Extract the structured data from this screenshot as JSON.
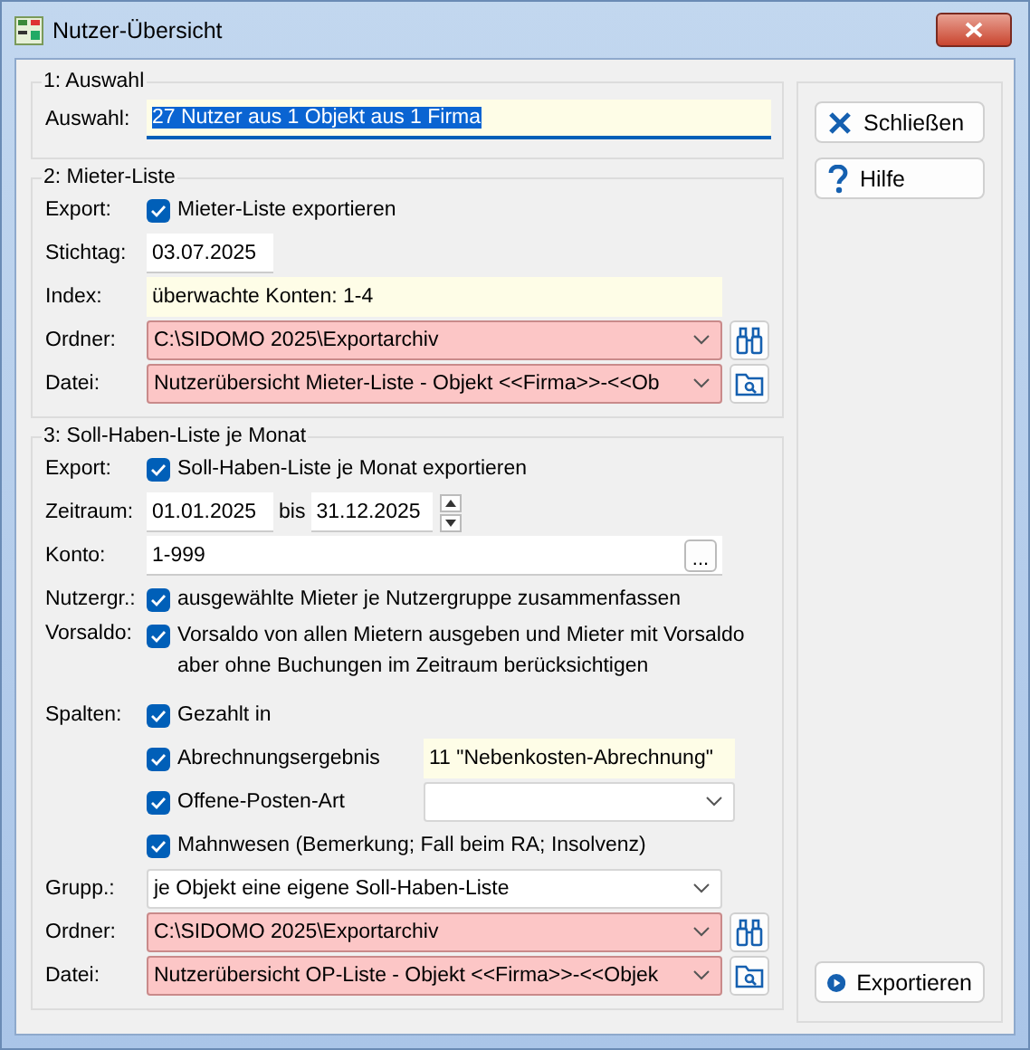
{
  "window": {
    "title": "Nutzer-Übersicht"
  },
  "sections": [
    {
      "title": "1: Auswahl",
      "rows": [
        {
          "kind": "field",
          "label": "Auswahl:",
          "value": "27 Nutzer aus 1 Objekt aus 1 Firma",
          "selected": true,
          "readonly": true,
          "focused": true
        }
      ]
    },
    {
      "title": "2: Mieter-Liste",
      "rows": [
        {
          "kind": "check",
          "label": "Export:",
          "text": "Mieter-Liste exportieren",
          "checked": true
        },
        {
          "kind": "date",
          "label": "Stichtag:",
          "value": "03.07.2025"
        },
        {
          "kind": "field",
          "label": "Index:",
          "value": "überwachte Konten: 1-4",
          "selected": false,
          "readonly": true,
          "focused": false
        },
        {
          "kind": "combo",
          "label": "Ordner:",
          "value": "C:\\SIDOMO 2025\\Exportarchiv",
          "invalid": true,
          "tool": {
            "kind": "binoculars"
          }
        },
        {
          "kind": "combo",
          "label": "Datei:",
          "value": "Nutzerübersicht Mieter-Liste - Objekt <<Firma>>-<<Ob",
          "invalid": true,
          "tool": {
            "kind": "folder"
          }
        }
      ]
    },
    {
      "title": "3: Soll-Haben-Liste je Monat",
      "rows": [
        {
          "kind": "check",
          "label": "Export:",
          "text": "Soll-Haben-Liste je Monat exportieren",
          "checked": true
        },
        {
          "kind": "range",
          "label": "Zeitraum:",
          "from": "01.01.2025",
          "separator": "bis",
          "to": "31.12.2025"
        },
        {
          "kind": "lookup",
          "label": "Konto:",
          "value": "1-999",
          "button": "..."
        },
        {
          "kind": "check",
          "label": "Nutzergr.:",
          "text": "ausgewählte Mieter je Nutzergruppe zusammenfassen",
          "checked": true
        },
        {
          "kind": "check",
          "label": "Vorsaldo:",
          "text": "Vorsaldo von allen Mietern ausgeben und Mieter mit Vorsaldo aber ohne Buchungen im Zeitraum berücksichtigen",
          "checked": true
        },
        {
          "kind": "check",
          "label": "Spalten:",
          "text": "Gezahlt in",
          "checked": true
        },
        {
          "kind": "check",
          "text": "Abrechnungsergebnis",
          "checked": true,
          "side": {
            "kind": "field",
            "value": "11 \"Nebenkosten-Abrechnung\"",
            "readonly": true
          }
        },
        {
          "kind": "check",
          "text": "Offene-Posten-Art",
          "checked": true,
          "side": {
            "kind": "combo"
          }
        },
        {
          "kind": "check",
          "text": "Mahnwesen (Bemerkung; Fall beim RA; Insolvenz)",
          "checked": true
        },
        {
          "kind": "combo",
          "label": "Grupp.:",
          "value": "je Objekt eine eigene Soll-Haben-Liste",
          "invalid": false
        },
        {
          "kind": "combo",
          "label": "Ordner:",
          "value": "C:\\SIDOMO 2025\\Exportarchiv",
          "invalid": true,
          "tool": {
            "kind": "binoculars"
          }
        },
        {
          "kind": "combo",
          "label": "Datei:",
          "value": "Nutzerübersicht OP-Liste - Objekt <<Firma>>-<<Objek",
          "invalid": true,
          "tool": {
            "kind": "folder"
          }
        }
      ]
    }
  ],
  "buttons": [
    {
      "label": "Schließen",
      "kind": "close"
    },
    {
      "label": "Hilfe",
      "kind": "help"
    }
  ],
  "bottom_button": {
    "label": "Exportieren",
    "kind": "run"
  }
}
